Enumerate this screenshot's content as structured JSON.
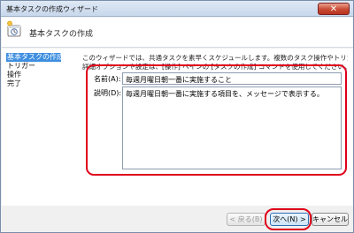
{
  "window": {
    "title": "基本タスクの作成ウィザード",
    "close_glyph": "✕"
  },
  "header": {
    "title": "基本タスクの作成",
    "icon": "task-scheduler-icon"
  },
  "steps": [
    {
      "label": "基本タスクの作成",
      "active": true
    },
    {
      "label": "トリガー",
      "active": false
    },
    {
      "label": "操作",
      "active": false
    },
    {
      "label": "完了",
      "active": false
    }
  ],
  "description": {
    "line1": "このウィザードでは、共通タスクを素早くスケジュールします。複数のタスク操作やトリガーなどの",
    "line2": "詳細オプションや設定は、[操作] ペインの [タスクの作成] コマンドを使用してください。"
  },
  "form": {
    "name_label": "名前(A):",
    "name_value": "毎週月曜日朝一番に実施すること",
    "description_label": "説明(D):",
    "description_value": "毎週月曜日朝一番に実施する項目を、メッセージで表示する。"
  },
  "footer": {
    "back_label": "< 戻る(B)",
    "next_label": "次へ(N) >",
    "cancel_label": "キャンセル"
  },
  "colors": {
    "highlight": "#e0001b",
    "selection": "#3e8ee0"
  }
}
